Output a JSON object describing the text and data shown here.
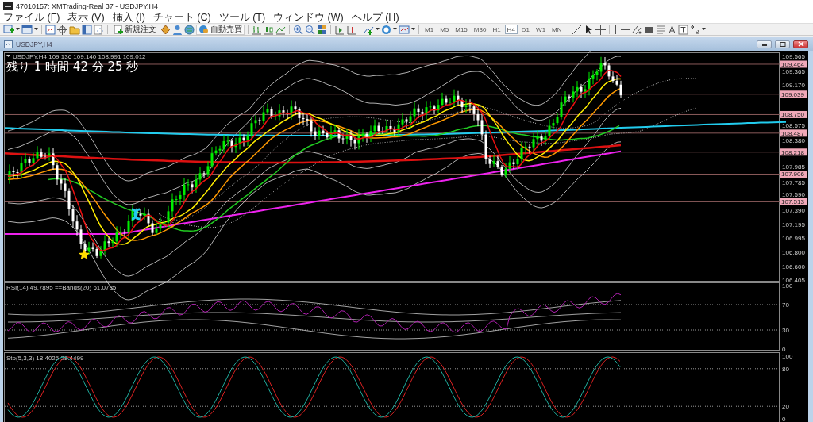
{
  "window": {
    "title": "47010157: XMTrading-Real 37 - USDJPY,H4"
  },
  "menu": [
    "ファイル (F)",
    "表示 (V)",
    "挿入 (I)",
    "チャート (C)",
    "ツール (T)",
    "ウィンドウ (W)",
    "ヘルプ (H)"
  ],
  "toolbar": {
    "new_order": "新規注文",
    "auto_trading": "自動売買",
    "timeframes": [
      {
        "label": "M1",
        "selected": false
      },
      {
        "label": "M5",
        "selected": false
      },
      {
        "label": "M15",
        "selected": false
      },
      {
        "label": "M30",
        "selected": false
      },
      {
        "label": "H1",
        "selected": false
      },
      {
        "label": "H4",
        "selected": true
      },
      {
        "label": "D1",
        "selected": false
      },
      {
        "label": "W1",
        "selected": false
      },
      {
        "label": "MN",
        "selected": false
      }
    ]
  },
  "chart_window": {
    "title": "USDJPY,H4"
  },
  "main_chart": {
    "info": "USDJPY,H4  109.136 109.140 108.991 109.012",
    "countdown": "残り 1 時間 42 分 25 秒",
    "price_axis": [
      {
        "label": "109.565",
        "kind": "tick"
      },
      {
        "label": "109.464",
        "kind": "level"
      },
      {
        "label": "109.365",
        "kind": "tick"
      },
      {
        "label": "109.170",
        "kind": "tick"
      },
      {
        "label": "109.039",
        "kind": "level"
      },
      {
        "label": "108.750",
        "kind": "level"
      },
      {
        "label": "108.575",
        "kind": "tick"
      },
      {
        "label": "108.487",
        "kind": "level"
      },
      {
        "label": "108.380",
        "kind": "tick"
      },
      {
        "label": "108.218",
        "kind": "level"
      },
      {
        "label": "107.985",
        "kind": "tick"
      },
      {
        "label": "107.906",
        "kind": "level"
      },
      {
        "label": "107.785",
        "kind": "tick"
      },
      {
        "label": "107.590",
        "kind": "tick"
      },
      {
        "label": "107.513",
        "kind": "level"
      },
      {
        "label": "107.390",
        "kind": "tick"
      },
      {
        "label": "107.195",
        "kind": "tick"
      },
      {
        "label": "106.995",
        "kind": "tick"
      },
      {
        "label": "106.800",
        "kind": "tick"
      },
      {
        "label": "106.600",
        "kind": "tick"
      },
      {
        "label": "106.405",
        "kind": "tick"
      }
    ]
  },
  "rsi": {
    "info": "RSI(14) 49.7895   ==Bands(20) 61.0735",
    "axis": [
      "100",
      "70",
      "30",
      "0"
    ]
  },
  "stochastic": {
    "info": "Sto(5,3,3) 18.4025 28.4499",
    "axis": [
      "100",
      "80",
      "20",
      "0"
    ]
  }
}
